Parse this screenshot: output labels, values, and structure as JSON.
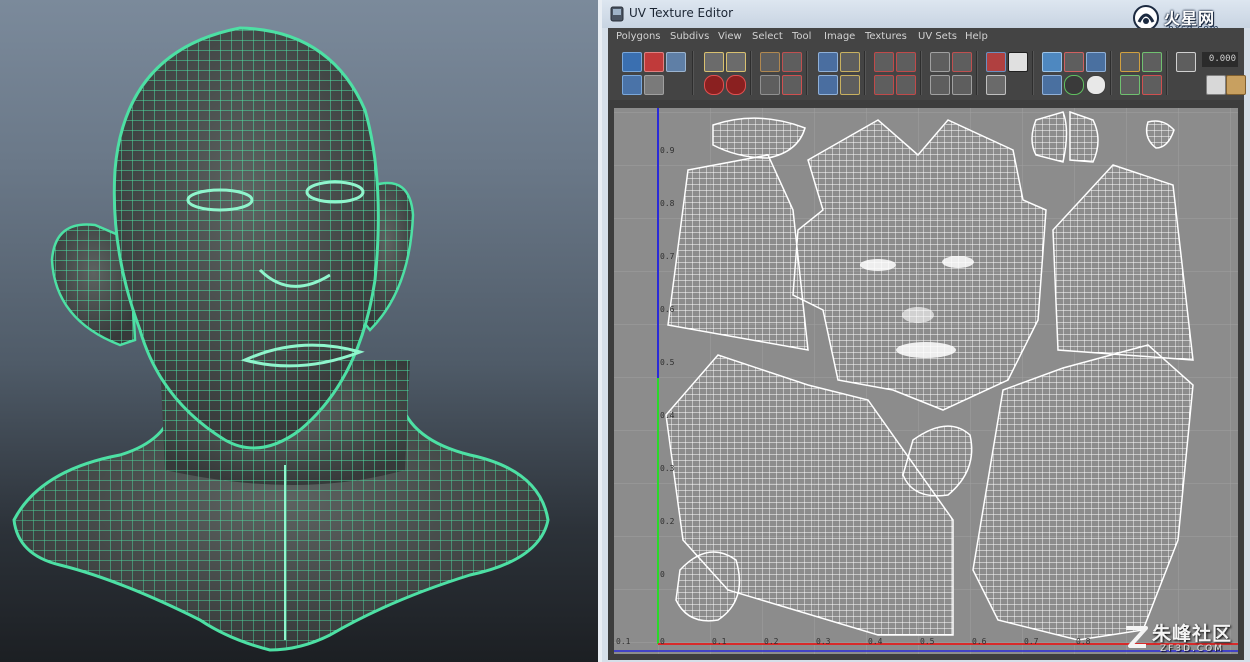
{
  "window": {
    "title": "UV Texture Editor"
  },
  "logo": {
    "text": "火星网",
    "url": "hxsd.com"
  },
  "menu": {
    "items": [
      "Polygons",
      "Subdivs",
      "View",
      "Select",
      "Tool",
      "Image",
      "Textures",
      "UV Sets",
      "Help"
    ]
  },
  "toolbar": {
    "value_field": "0.000"
  },
  "uv_grid": {
    "x_ticks": [
      "0.1",
      "0",
      "0.1",
      "0.2",
      "0.3",
      "0.4",
      "0.5",
      "0.6",
      "0.7",
      "0.8"
    ],
    "y_ticks": [
      "0.9",
      "0.8",
      "0.7",
      "0.6",
      "0.5",
      "0.4",
      "0.3",
      "0.2",
      "0"
    ]
  },
  "watermark": {
    "text": "朱峰社区",
    "url": "ZF3D.COM"
  },
  "colors": {
    "wire_green": "#4de0a4",
    "uv_bg": "#8c8c8c",
    "uv_wire": "#ffffff",
    "axis_blue": "#2a2ad8",
    "axis_red": "#d82a2a",
    "axis_green": "#2ad82a"
  }
}
